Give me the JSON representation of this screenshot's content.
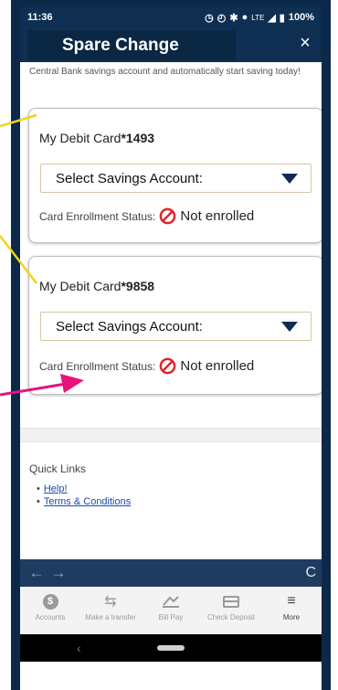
{
  "status_bar": {
    "time": "11:36",
    "network": "LTE",
    "battery": "100%"
  },
  "header": {
    "title": "Spare Change",
    "close_glyph": "×"
  },
  "intro_text": "Central Bank savings account and automatically start saving today!",
  "cards": [
    {
      "prefix": "My Debit Card",
      "number": "*1493",
      "select_label": "Select Savings Account:",
      "status_label": "Card Enrollment Status:",
      "status_value": "Not enrolled"
    },
    {
      "prefix": "My Debit Card",
      "number": "*9858",
      "select_label": "Select Savings Account:",
      "status_label": "Card Enrollment Status:",
      "status_value": "Not enrolled"
    }
  ],
  "quick_links": {
    "title": "Quick Links",
    "items": [
      "Help!",
      "Terms & Conditions"
    ]
  },
  "browser_nav": {
    "back_glyph": "←",
    "forward_glyph": "→",
    "refresh_glyph": "C"
  },
  "tabs": [
    {
      "label": "Accounts",
      "icon": "dollar-coin-icon"
    },
    {
      "label": "Make a transfer",
      "icon": "transfer-arrows-icon"
    },
    {
      "label": "Bill Pay",
      "icon": "bill-pay-icon"
    },
    {
      "label": "Check Deposit",
      "icon": "check-deposit-icon"
    },
    {
      "label": "More",
      "icon": "hamburger-icon"
    }
  ],
  "colors": {
    "header_bg": "#0f2f52",
    "link": "#1a4aa8",
    "not_enrolled_icon": "#e0242a",
    "annotation_yellow": "#f3d31b",
    "annotation_pink": "#e8127c"
  }
}
